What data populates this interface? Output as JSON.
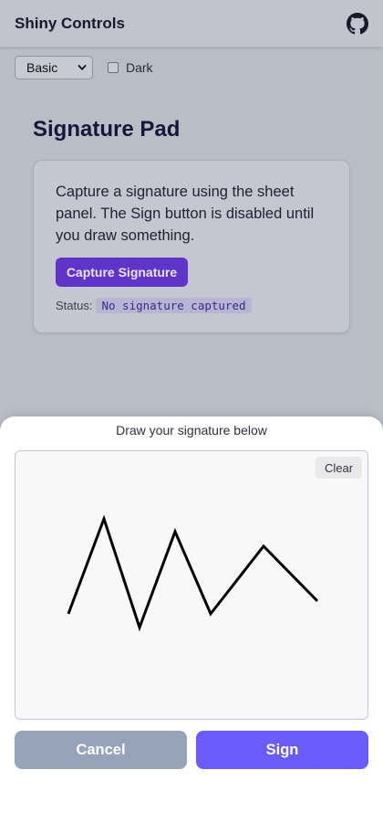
{
  "header": {
    "title": "Shiny Controls",
    "github_icon": "github-icon"
  },
  "controls": {
    "theme_select": {
      "value": "Basic",
      "icon": "chevron-down-icon"
    },
    "dark_toggle": {
      "label": "Dark",
      "checked": false
    }
  },
  "page": {
    "title": "Signature Pad"
  },
  "card": {
    "description": "Capture a signature using the sheet panel. The Sign button is disabled until you draw something.",
    "capture_button": "Capture Signature",
    "status_label": "Status:",
    "status_value": "No signature captured"
  },
  "sheet": {
    "heading": "Draw your signature below",
    "clear_button": "Clear",
    "cancel_button": "Cancel",
    "sign_button": "Sign"
  },
  "colors": {
    "accent": "#5e35c8",
    "sign": "#6a5bfc",
    "cancel": "#97a3b8",
    "overlay": "#b9bdc6"
  }
}
